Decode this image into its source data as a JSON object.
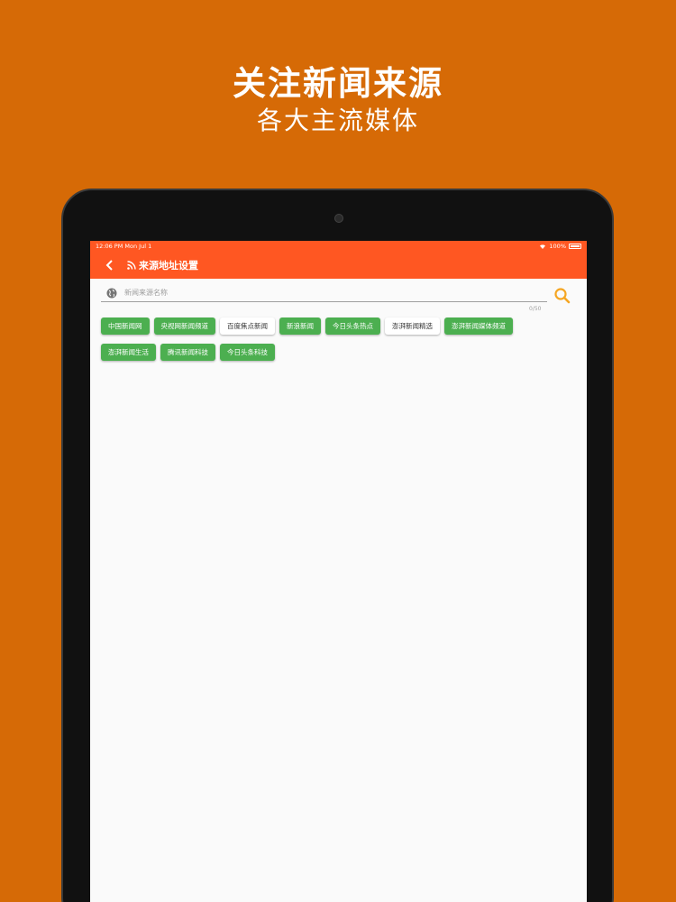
{
  "promo": {
    "title": "关注新闻来源",
    "subtitle": "各大主流媒体"
  },
  "status": {
    "time_date": "12:06 PM  Mon Jul 1",
    "battery": "100%"
  },
  "appbar": {
    "title": "来源地址设置"
  },
  "search": {
    "placeholder": "新闻来源名称",
    "value": "",
    "counter": "0/50"
  },
  "chips": [
    {
      "label": "中国新闻网",
      "selected": true
    },
    {
      "label": "央视网新闻频道",
      "selected": true
    },
    {
      "label": "百度焦点新闻",
      "selected": false
    },
    {
      "label": "新浪新闻",
      "selected": true
    },
    {
      "label": "今日头条热点",
      "selected": true
    },
    {
      "label": "澎湃新闻精选",
      "selected": false
    },
    {
      "label": "澎湃新闻媒体频道",
      "selected": true
    },
    {
      "label": "澎湃新闻生活",
      "selected": true
    },
    {
      "label": "腾讯新闻科技",
      "selected": true
    },
    {
      "label": "今日头条科技",
      "selected": true
    }
  ],
  "colors": {
    "background": "#D66A06",
    "appbar": "#FF5722",
    "chip_selected": "#4CAF50",
    "search_icon": "#F5A623"
  }
}
